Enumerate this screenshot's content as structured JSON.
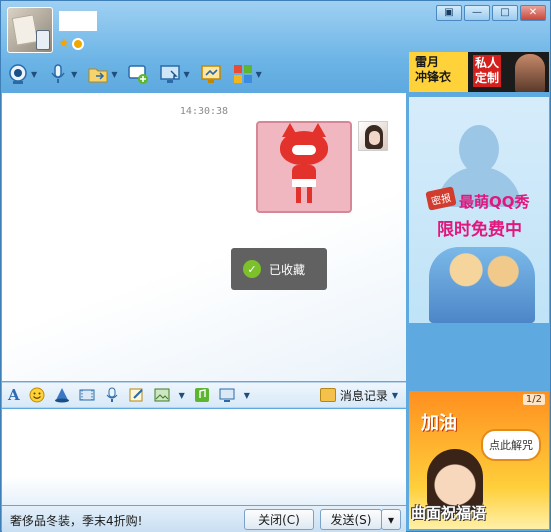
{
  "title_bar": {
    "controls": [
      "▣",
      "—",
      "□",
      "✕"
    ]
  },
  "toolbar": {
    "items": [
      {
        "name": "video-call",
        "icon": "webcam-icon"
      },
      {
        "name": "voice-call",
        "icon": "microphone-icon"
      },
      {
        "name": "send-file",
        "icon": "folder-icon"
      },
      {
        "name": "create-group",
        "icon": "chat-add-icon"
      },
      {
        "name": "remote-assist",
        "icon": "remote-desktop-icon"
      },
      {
        "name": "share-screen",
        "icon": "screen-share-icon"
      },
      {
        "name": "apps",
        "icon": "apps-grid-icon"
      }
    ]
  },
  "ads": {
    "top": {
      "left_text": "雷月\n冲锋衣",
      "right_text": "私人\n定制"
    },
    "side": {
      "tag": "密报",
      "line1": "最萌QQ秀",
      "line2": "限时免费中"
    },
    "bottom": {
      "pager": "1/2",
      "headline": "加油",
      "bubble": "点此解咒",
      "footer": "曲面祝福语"
    }
  },
  "chat": {
    "timestamp": "14:30:38",
    "toast": "已收藏"
  },
  "input_toolbar": {
    "history_label": "消息记录"
  },
  "bottom_bar": {
    "promo_text": "奢侈品冬装，季末4折购!",
    "close_label": "关闭(C)",
    "send_label": "发送(S)",
    "send_more": "▾"
  },
  "colors": {
    "window_blue": "#5ea9df",
    "toast_bg": "#505050",
    "check_green": "#7cc12a",
    "sticker_pink": "#f0b7c1"
  }
}
